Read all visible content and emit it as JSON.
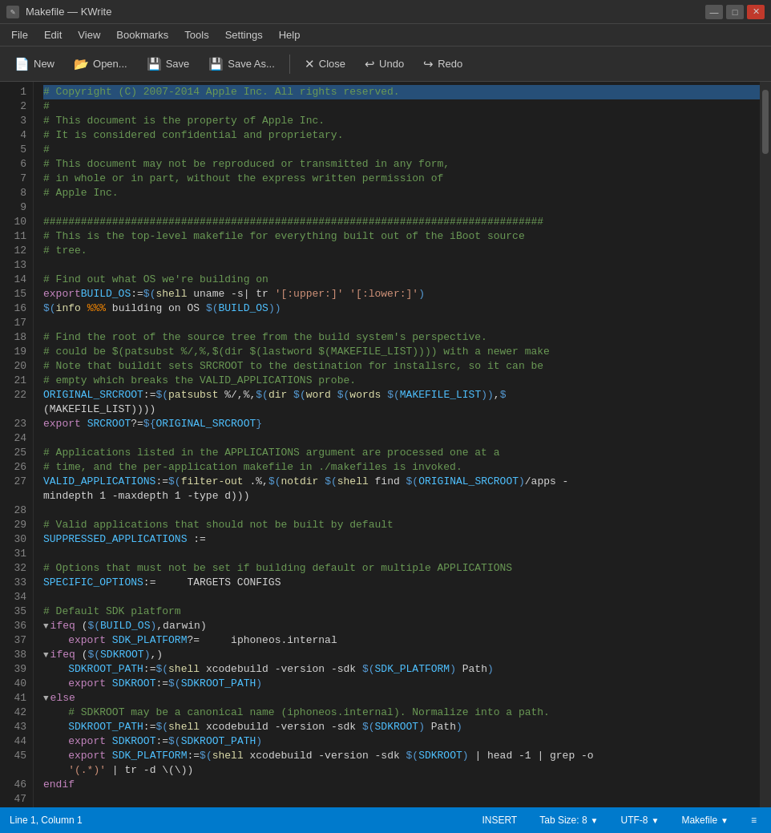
{
  "titlebar": {
    "title": "Makefile — KWrite",
    "icon": "✎",
    "minimize_label": "—",
    "maximize_label": "□",
    "close_label": "✕"
  },
  "menubar": {
    "items": [
      "File",
      "Edit",
      "View",
      "Bookmarks",
      "Tools",
      "Settings",
      "Help"
    ]
  },
  "toolbar": {
    "buttons": [
      {
        "id": "new",
        "icon": "📄",
        "label": "New"
      },
      {
        "id": "open",
        "icon": "📂",
        "label": "Open..."
      },
      {
        "id": "save",
        "icon": "💾",
        "label": "Save"
      },
      {
        "id": "save-as",
        "icon": "💾",
        "label": "Save As..."
      },
      {
        "id": "close",
        "icon": "✕",
        "label": "Close"
      },
      {
        "id": "undo",
        "icon": "↩",
        "label": "Undo"
      },
      {
        "id": "redo",
        "icon": "↪",
        "label": "Redo"
      }
    ]
  },
  "editor": {
    "lines": 47,
    "first_line_selected": true
  },
  "statusbar": {
    "position": "Line 1, Column 1",
    "mode": "INSERT",
    "tab_size": "Tab Size: 8",
    "encoding": "UTF-8",
    "syntax": "Makefile"
  }
}
